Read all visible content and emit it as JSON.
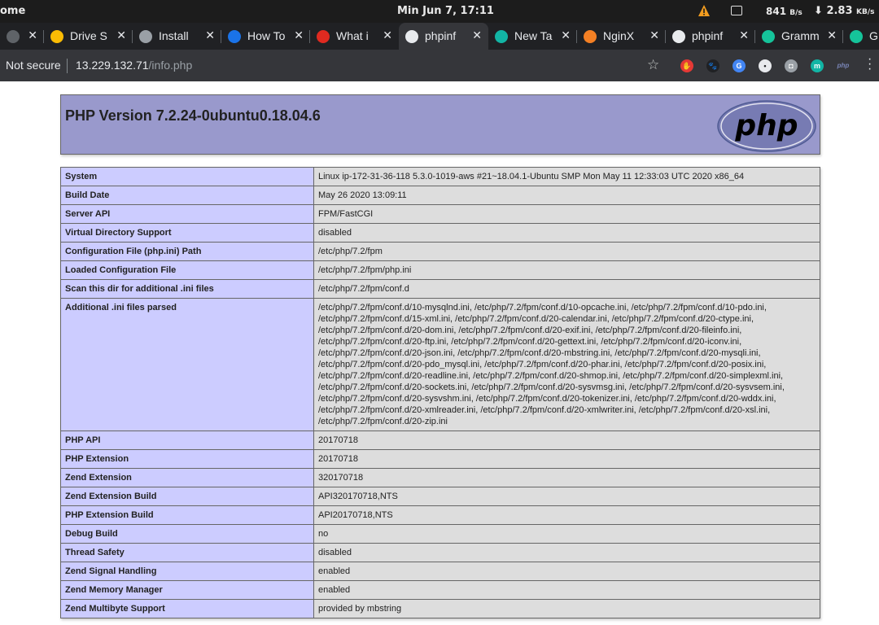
{
  "system_bar": {
    "app_name": "ome",
    "clock": "Min Jun  7, 17:11",
    "net_down_value": "841",
    "net_down_unit": "B/s",
    "net_up_value": "2.83",
    "net_up_unit": "KB/s",
    "arrow": "⬇"
  },
  "tabs": [
    {
      "title": "",
      "icon": "speaker-icon",
      "color": "#5f6368"
    },
    {
      "title": "Drive S",
      "icon": "google-drive-icon",
      "color": "#fbbc04"
    },
    {
      "title": "Install",
      "icon": "avatar-icon",
      "color": "#9aa0a6"
    },
    {
      "title": "How To",
      "icon": "digitalocean-icon",
      "color": "#1a73e8"
    },
    {
      "title": "What i",
      "icon": "askubuntu-icon",
      "color": "#e02a20"
    },
    {
      "title": "phpinf",
      "icon": "globe-icon",
      "color": "#e8eaed"
    },
    {
      "title": "New Ta",
      "icon": "m-icon",
      "color": "#12b5a5"
    },
    {
      "title": "NginX",
      "icon": "stackoverflow-icon",
      "color": "#f48024"
    },
    {
      "title": "phpinf",
      "icon": "globe-icon",
      "color": "#e8eaed"
    },
    {
      "title": "Gramm",
      "icon": "grammarly-icon",
      "color": "#15c39a"
    },
    {
      "title": "G",
      "icon": "grammarly-icon",
      "color": "#15c39a"
    }
  ],
  "address_bar": {
    "security": "Not secure",
    "url_host": "13.229.132.71",
    "url_path": "/info.php"
  },
  "extensions": [
    {
      "name": "adblock-icon",
      "color": "#e53935",
      "label": "✋"
    },
    {
      "name": "paw-icon",
      "color": "#202124",
      "label": "🐾"
    },
    {
      "name": "translate-icon",
      "color": "#4285f4",
      "label": "G"
    },
    {
      "name": "dots-icon",
      "color": "#e8eaed",
      "label": "•"
    },
    {
      "name": "camera-icon",
      "color": "#9aa0a6",
      "label": "◘"
    },
    {
      "name": "m-ext-icon",
      "color": "#12b5a5",
      "label": "m"
    },
    {
      "name": "php-ext-icon",
      "color": "#7a86b8",
      "label": "php"
    }
  ],
  "php": {
    "heading": "PHP Version 7.2.24-0ubuntu0.18.04.6",
    "logo_text": "php",
    "rows": [
      {
        "key": "System",
        "value": "Linux ip-172-31-36-118 5.3.0-1019-aws #21~18.04.1-Ubuntu SMP Mon May 11 12:33:03 UTC 2020 x86_64"
      },
      {
        "key": "Build Date",
        "value": "May 26 2020 13:09:11"
      },
      {
        "key": "Server API",
        "value": "FPM/FastCGI"
      },
      {
        "key": "Virtual Directory Support",
        "value": "disabled"
      },
      {
        "key": "Configuration File (php.ini) Path",
        "value": "/etc/php/7.2/fpm"
      },
      {
        "key": "Loaded Configuration File",
        "value": "/etc/php/7.2/fpm/php.ini"
      },
      {
        "key": "Scan this dir for additional .ini files",
        "value": "/etc/php/7.2/fpm/conf.d"
      },
      {
        "key": "Additional .ini files parsed",
        "value": "/etc/php/7.2/fpm/conf.d/10-mysqlnd.ini, /etc/php/7.2/fpm/conf.d/10-opcache.ini, /etc/php/7.2/fpm/conf.d/10-pdo.ini, /etc/php/7.2/fpm/conf.d/15-xml.ini, /etc/php/7.2/fpm/conf.d/20-calendar.ini, /etc/php/7.2/fpm/conf.d/20-ctype.ini, /etc/php/7.2/fpm/conf.d/20-dom.ini, /etc/php/7.2/fpm/conf.d/20-exif.ini, /etc/php/7.2/fpm/conf.d/20-fileinfo.ini, /etc/php/7.2/fpm/conf.d/20-ftp.ini, /etc/php/7.2/fpm/conf.d/20-gettext.ini, /etc/php/7.2/fpm/conf.d/20-iconv.ini, /etc/php/7.2/fpm/conf.d/20-json.ini, /etc/php/7.2/fpm/conf.d/20-mbstring.ini, /etc/php/7.2/fpm/conf.d/20-mysqli.ini, /etc/php/7.2/fpm/conf.d/20-pdo_mysql.ini, /etc/php/7.2/fpm/conf.d/20-phar.ini, /etc/php/7.2/fpm/conf.d/20-posix.ini, /etc/php/7.2/fpm/conf.d/20-readline.ini, /etc/php/7.2/fpm/conf.d/20-shmop.ini, /etc/php/7.2/fpm/conf.d/20-simplexml.ini, /etc/php/7.2/fpm/conf.d/20-sockets.ini, /etc/php/7.2/fpm/conf.d/20-sysvmsg.ini, /etc/php/7.2/fpm/conf.d/20-sysvsem.ini, /etc/php/7.2/fpm/conf.d/20-sysvshm.ini, /etc/php/7.2/fpm/conf.d/20-tokenizer.ini, /etc/php/7.2/fpm/conf.d/20-wddx.ini, /etc/php/7.2/fpm/conf.d/20-xmlreader.ini, /etc/php/7.2/fpm/conf.d/20-xmlwriter.ini, /etc/php/7.2/fpm/conf.d/20-xsl.ini, /etc/php/7.2/fpm/conf.d/20-zip.ini"
      },
      {
        "key": "PHP API",
        "value": "20170718"
      },
      {
        "key": "PHP Extension",
        "value": "20170718"
      },
      {
        "key": "Zend Extension",
        "value": "320170718"
      },
      {
        "key": "Zend Extension Build",
        "value": "API320170718,NTS"
      },
      {
        "key": "PHP Extension Build",
        "value": "API20170718,NTS"
      },
      {
        "key": "Debug Build",
        "value": "no"
      },
      {
        "key": "Thread Safety",
        "value": "disabled"
      },
      {
        "key": "Zend Signal Handling",
        "value": "enabled"
      },
      {
        "key": "Zend Memory Manager",
        "value": "enabled"
      },
      {
        "key": "Zend Multibyte Support",
        "value": "provided by mbstring"
      }
    ]
  }
}
